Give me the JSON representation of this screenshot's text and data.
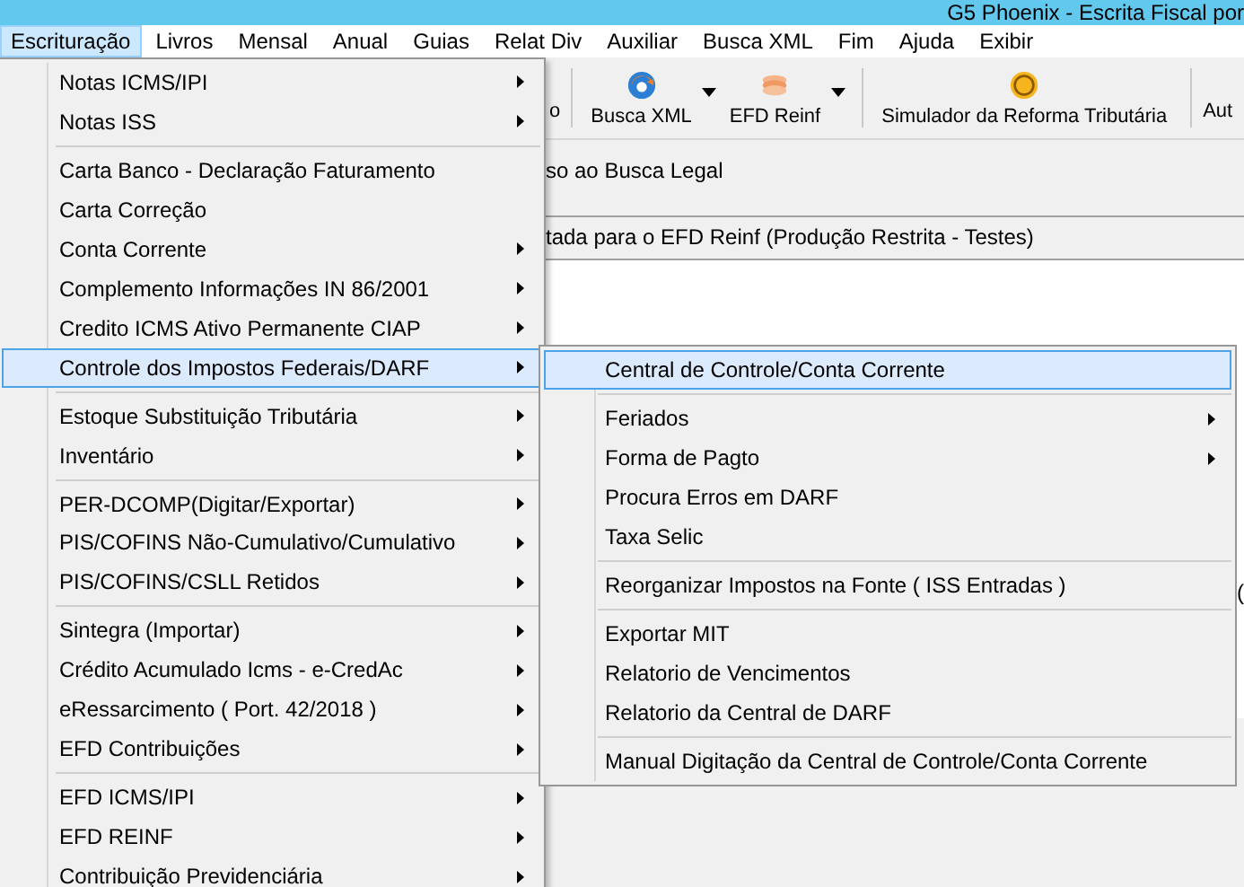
{
  "window": {
    "title": "G5 Phoenix - Escrita Fiscal por"
  },
  "menu_bar": [
    {
      "label": "Escrituração",
      "selected": true
    },
    {
      "label": "Livros",
      "selected": false
    },
    {
      "label": "Mensal",
      "selected": false
    },
    {
      "label": "Anual",
      "selected": false
    },
    {
      "label": "Guias",
      "selected": false
    },
    {
      "label": "Relat Div",
      "selected": false
    },
    {
      "label": "Auxiliar",
      "selected": false
    },
    {
      "label": "Busca XML",
      "selected": false
    },
    {
      "label": "Fim",
      "selected": false
    },
    {
      "label": "Ajuda",
      "selected": false
    },
    {
      "label": "Exibir",
      "selected": false
    }
  ],
  "toolbar": [
    {
      "kind": "text",
      "label": "o"
    },
    {
      "kind": "separator"
    },
    {
      "kind": "split",
      "label": "Busca XML"
    },
    {
      "kind": "split",
      "label": "EFD Reinf"
    },
    {
      "kind": "separator"
    },
    {
      "kind": "button",
      "label": "Simulador da Reforma Tributária"
    },
    {
      "kind": "separator"
    },
    {
      "kind": "text",
      "label": "Aut"
    }
  ],
  "content": {
    "lines": [
      "so ao Busca Legal",
      "tada para o EFD Reinf (Produção Restrita - Testes)"
    ],
    "edge_text": "("
  },
  "menu": {
    "items": [
      {
        "kind": "item",
        "label": "Notas ICMS/IPI",
        "submenu": true,
        "selected": false
      },
      {
        "kind": "item",
        "label": "Notas ISS",
        "submenu": true,
        "selected": false
      },
      {
        "kind": "separator"
      },
      {
        "kind": "item",
        "label": "Carta Banco - Declaração Faturamento",
        "submenu": false,
        "selected": false
      },
      {
        "kind": "item",
        "label": "Carta Correção",
        "submenu": false,
        "selected": false
      },
      {
        "kind": "item",
        "label": "Conta Corrente",
        "submenu": true,
        "selected": false
      },
      {
        "kind": "item",
        "label": "Complemento Informações IN 86/2001",
        "submenu": true,
        "selected": false
      },
      {
        "kind": "item",
        "label": "Credito ICMS Ativo Permanente CIAP",
        "submenu": true,
        "selected": false
      },
      {
        "kind": "item",
        "label": "Controle dos Impostos Federais/DARF",
        "submenu": true,
        "selected": true
      },
      {
        "kind": "separator"
      },
      {
        "kind": "item",
        "label": "Estoque Substituição Tributária",
        "submenu": true,
        "selected": false
      },
      {
        "kind": "item",
        "label": "Inventário",
        "submenu": true,
        "selected": false
      },
      {
        "kind": "separator"
      },
      {
        "kind": "item",
        "label": "PER-DCOMP(Digitar/Exportar)",
        "submenu": true,
        "selected": false
      },
      {
        "kind": "item",
        "label": "PIS/COFINS Não-Cumulativo/Cumulativo",
        "submenu": true,
        "selected": false
      },
      {
        "kind": "item",
        "label": "PIS/COFINS/CSLL Retidos",
        "submenu": true,
        "selected": false
      },
      {
        "kind": "separator"
      },
      {
        "kind": "item",
        "label": "Sintegra (Importar)",
        "submenu": true,
        "selected": false
      },
      {
        "kind": "item",
        "label": "Crédito Acumulado Icms - e-CredAc",
        "submenu": true,
        "selected": false
      },
      {
        "kind": "item",
        "label": "eRessarcimento ( Port. 42/2018 )",
        "submenu": true,
        "selected": false
      },
      {
        "kind": "item",
        "label": "EFD Contribuições",
        "submenu": true,
        "selected": false
      },
      {
        "kind": "separator"
      },
      {
        "kind": "item",
        "label": "EFD ICMS/IPI",
        "submenu": true,
        "selected": false
      },
      {
        "kind": "item",
        "label": "EFD REINF",
        "submenu": true,
        "selected": false
      },
      {
        "kind": "item",
        "label": "Contribuição Previdenciária",
        "submenu": true,
        "selected": false
      }
    ]
  },
  "submenu": {
    "items": [
      {
        "kind": "item",
        "label": "Central de Controle/Conta Corrente",
        "submenu": false,
        "selected": true
      },
      {
        "kind": "separator"
      },
      {
        "kind": "item",
        "label": "Feriados",
        "submenu": true,
        "selected": false
      },
      {
        "kind": "item",
        "label": "Forma de Pagto",
        "submenu": true,
        "selected": false
      },
      {
        "kind": "item",
        "label": "Procura Erros em DARF",
        "submenu": false,
        "selected": false
      },
      {
        "kind": "item",
        "label": "Taxa Selic",
        "submenu": false,
        "selected": false
      },
      {
        "kind": "separator"
      },
      {
        "kind": "item",
        "label": "Reorganizar Impostos na Fonte ( ISS Entradas )",
        "submenu": false,
        "selected": false
      },
      {
        "kind": "separator"
      },
      {
        "kind": "item",
        "label": "Exportar MIT",
        "submenu": false,
        "selected": false
      },
      {
        "kind": "item",
        "label": "Relatorio de Vencimentos",
        "submenu": false,
        "selected": false
      },
      {
        "kind": "item",
        "label": "Relatorio da Central de DARF",
        "submenu": false,
        "selected": false
      },
      {
        "kind": "separator"
      },
      {
        "kind": "item",
        "label": "Manual Digitação da Central de Controle/Conta Corrente",
        "submenu": false,
        "selected": false
      }
    ]
  }
}
